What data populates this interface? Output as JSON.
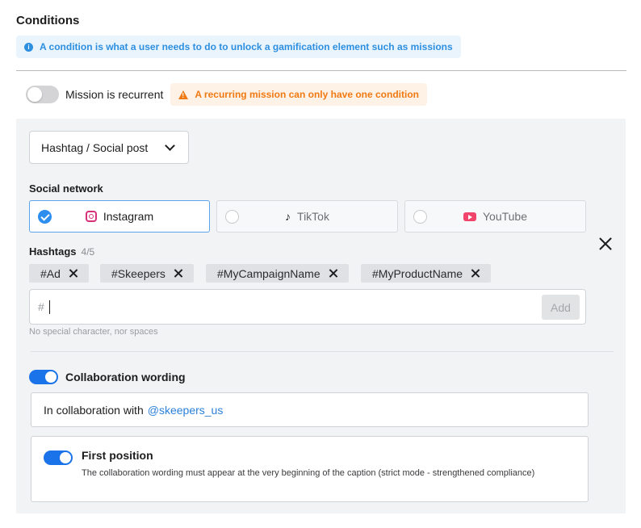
{
  "section": {
    "title": "Conditions",
    "info_icon": "info-circle-icon",
    "info_text": "A condition is what a user needs to do to unlock a gamification element such as missions"
  },
  "recurrent": {
    "label": "Mission is recurrent",
    "enabled": false,
    "warning_icon": "warning-triangle-icon",
    "warning_text": "A recurring mission can only have one condition",
    "warning_color": "#f07a12"
  },
  "condition": {
    "type_select": {
      "value": "Hashtag / Social post"
    },
    "social_network": {
      "label": "Social network",
      "options": [
        {
          "label": "Instagram",
          "icon": "instagram-icon",
          "selected": true
        },
        {
          "label": "TikTok",
          "icon": "tiktok-icon",
          "selected": false
        },
        {
          "label": "YouTube",
          "icon": "youtube-icon",
          "selected": false
        }
      ]
    },
    "hashtags": {
      "label": "Hashtags",
      "count": "4/5",
      "tags": [
        "#Ad",
        "#Skeepers",
        "#MyCampaignName",
        "#MyProductName"
      ],
      "input_prefix": "#",
      "input_value": "",
      "add_label": "Add",
      "hint": "No special character, nor spaces"
    },
    "collaboration": {
      "title": "Collaboration wording",
      "enabled": true,
      "text_prefix": "In collaboration with",
      "mention": "@skeepers_us",
      "first_position": {
        "title": "First position",
        "enabled": true,
        "description": "The collaboration wording must appear at the very beginning of the caption (strict mode - strengthened compliance)"
      }
    }
  },
  "colors": {
    "accent": "#1a73e8",
    "info": "#2d8fe0",
    "mention": "#2c80d9"
  }
}
